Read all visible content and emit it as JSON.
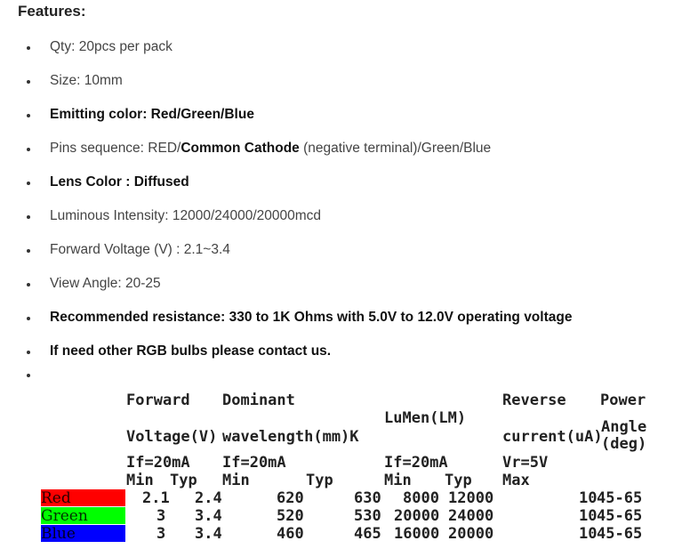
{
  "title": "Features:",
  "features": [
    {
      "text": "Qty: 20pcs per pack",
      "bold": false
    },
    {
      "text": "Size: 10mm",
      "bold": false
    },
    {
      "text": "Emitting color: Red/Green/Blue",
      "bold": true
    },
    {
      "text_a": "Pins sequence: RED/",
      "text_b": "Common Cathode",
      "text_c": " (negative terminal)/Green/Blue",
      "mixed": true
    },
    {
      "text": "Lens Color : Diffused",
      "bold": true
    },
    {
      "text": "Luminous Intensity: 12000/24000/20000mcd",
      "bold": false
    },
    {
      "text": "Forward Voltage (V) : 2.1~3.4",
      "bold": false
    },
    {
      "text": "View Angle: 20-25",
      "bold": false
    },
    {
      "text": "Recommended resistance: 330 to 1K Ohms with 5.0V to 12.0V operating voltage",
      "bold": true
    },
    {
      "text": "If need other RGB bulbs please contact us.",
      "bold": true
    },
    {
      "text": "",
      "bold": false
    }
  ],
  "table": {
    "h_forward": "Forward",
    "h_dominant": "Dominant",
    "h_reverse": "Reverse",
    "h_power": "Power",
    "h_lumen": "LuMen(LM)",
    "h_angle_1": "Angle",
    "h_angle_2": "(deg)",
    "h_voltage": "Voltage(V)",
    "h_wavelength": "wavelength(mm)K",
    "h_current": "current(uA)",
    "c_if1": "If=20mA",
    "c_if2": "If=20mA",
    "c_if3": "If=20mA",
    "c_vr": "Vr=5V",
    "m_min1": "Min",
    "m_typ1": "Typ",
    "m_min2": "Min",
    "m_typ2": "Typ",
    "m_min3": "Min",
    "m_typ3": "Typ",
    "m_max": "Max",
    "rows": [
      {
        "color_name": "Red",
        "bg": "#ff0000",
        "fg": "#1a0000",
        "v_min": "2.1",
        "v_typ": "2.4",
        "wl_min": "620",
        "wl_typ": "630",
        "lm_min": "8000",
        "lm_typ": "12000",
        "rev_max": "10",
        "angle": "45-65"
      },
      {
        "color_name": "Green",
        "bg": "#00ff00",
        "fg": "#003300",
        "v_min": "3",
        "v_typ": "3.4",
        "wl_min": "520",
        "wl_typ": "530",
        "lm_min": "20000",
        "lm_typ": "24000",
        "rev_max": "10",
        "angle": "45-65"
      },
      {
        "color_name": "Blue",
        "bg": "#0000ff",
        "fg": "#000033",
        "v_min": "3",
        "v_typ": "3.4",
        "wl_min": "460",
        "wl_typ": "465",
        "lm_min": "16000",
        "lm_typ": "20000",
        "rev_max": "10",
        "angle": "45-65"
      }
    ]
  }
}
